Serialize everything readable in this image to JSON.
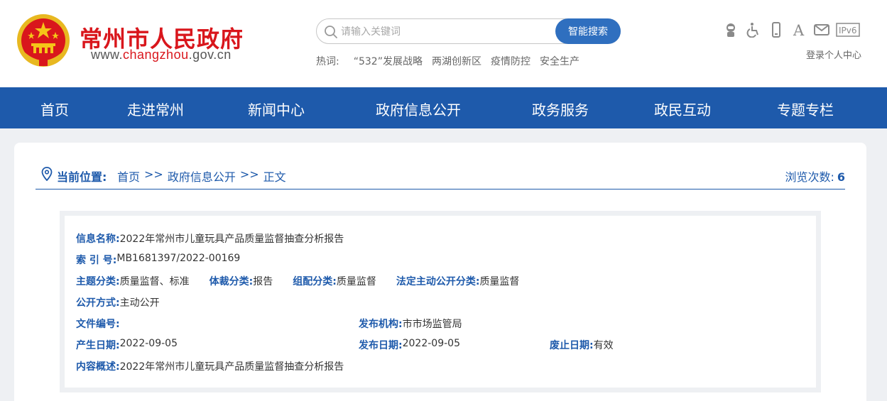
{
  "header": {
    "title": "常州市人民政府",
    "url_prefix": "www.",
    "url_accent": "changzhou",
    "url_suffix": ".gov.cn",
    "search_placeholder": "请输入关键词",
    "search_button": "智能搜索",
    "hot_label": "热词:",
    "hot_words": [
      "“532”发展战略",
      "两湖创新区",
      "疫情防控",
      "安全生产"
    ],
    "tools": [
      "robot-icon",
      "accessibility-icon",
      "mobile-icon",
      "font-size-icon",
      "mail-icon",
      "ipv6-icon"
    ],
    "ipv6_text": "IPv6",
    "font_icon_text": "A",
    "login": "登录个人中心"
  },
  "nav": [
    "首页",
    "走进常州",
    "新闻中心",
    "政府信息公开",
    "政务服务",
    "政民互动",
    "专题专栏"
  ],
  "breadcrumb": {
    "label": "当前位置:",
    "items": [
      "首页",
      "政府信息公开",
      "正文"
    ],
    "sep": ">>",
    "views_label": "浏览次数:",
    "views_count": "6"
  },
  "info": {
    "name_label": "信息名称:",
    "name": "2022年常州市儿童玩具产品质量监督抽查分析报告",
    "index_label": "索 引 号:",
    "index": "MB1681397/2022-00169",
    "topic_label": "主题分类:",
    "topic": "质量监督、标准",
    "genre_label": "体裁分类:",
    "genre": "报告",
    "config_label": "组配分类:",
    "config": "质量监督",
    "legal_label": "法定主动公开分类:",
    "legal": "质量监督",
    "method_label": "公开方式:",
    "method": "主动公开",
    "docno_label": "文件编号:",
    "docno": "",
    "org_label": "发布机构:",
    "org": "市市场监管局",
    "created_label": "产生日期:",
    "created": "2022-09-05",
    "published_label": "发布日期:",
    "published": "2022-09-05",
    "expire_label": "废止日期:",
    "expire": "有效",
    "summary_label": "内容概述:",
    "summary": "2022年常州市儿童玩具产品质量监督抽查分析报告"
  },
  "colors": {
    "brand_red": "#d9161c",
    "nav_blue": "#1e5aab",
    "button_blue": "#2f6fbf"
  }
}
